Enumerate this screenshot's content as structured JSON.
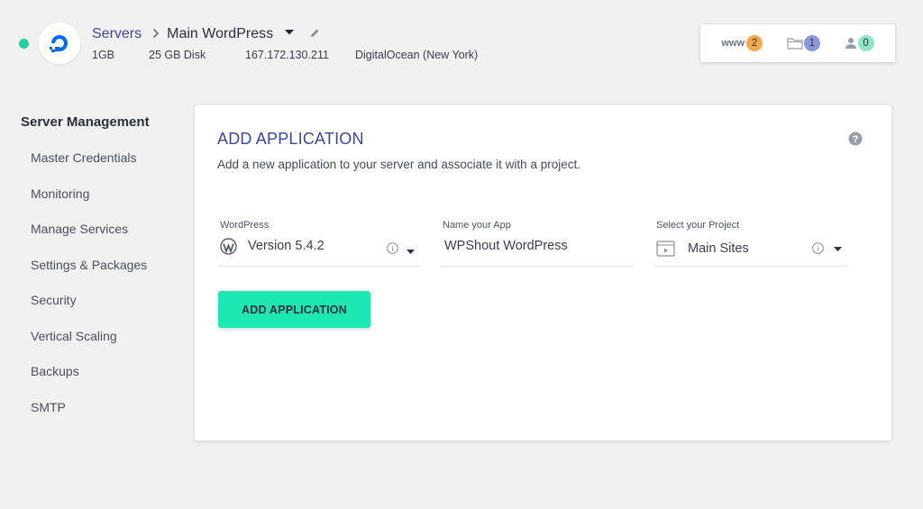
{
  "header": {
    "breadcrumb_link": "Servers",
    "server_name": "Main WordPress",
    "meta": {
      "ram": "1GB",
      "disk": "25 GB Disk",
      "ip": "167.172.130.211",
      "provider": "DigitalOcean (New York)"
    },
    "stats": {
      "www_label": "www",
      "www_count": "2",
      "folder_count": "1",
      "user_count": "0"
    }
  },
  "colors": {
    "status": "#1ed19c",
    "accent": "#3d45a0",
    "button": "#1de7b2",
    "www_badge": "#f7a94a",
    "folder_badge": "#8c97de",
    "user_badge": "#8de7c8"
  },
  "sidebar": {
    "title": "Server Management",
    "items": [
      {
        "label": "Master Credentials"
      },
      {
        "label": "Monitoring"
      },
      {
        "label": "Manage Services"
      },
      {
        "label": "Settings & Packages"
      },
      {
        "label": "Security"
      },
      {
        "label": "Vertical Scaling"
      },
      {
        "label": "Backups"
      },
      {
        "label": "SMTP"
      }
    ]
  },
  "card": {
    "title": "ADD APPLICATION",
    "description": "Add a new application to your server and associate it with a project.",
    "fields": {
      "app_type": {
        "label": "WordPress",
        "value": "Version 5.4.2",
        "icon": "wordpress-icon"
      },
      "app_name": {
        "label": "Name your App",
        "value": "WPShout WordPress"
      },
      "project": {
        "label": "Select your Project",
        "value": "Main Sites",
        "icon": "project-icon"
      }
    },
    "button_label": "ADD APPLICATION"
  }
}
